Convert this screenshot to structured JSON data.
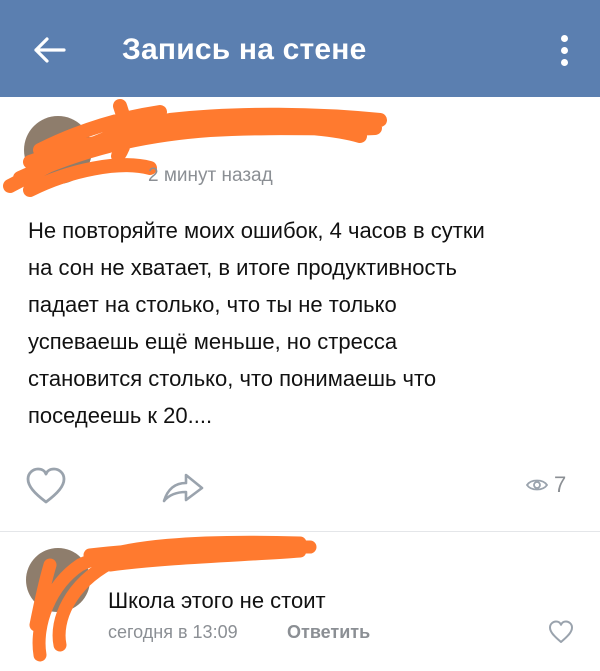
{
  "header": {
    "title": "Запись на стене",
    "background": "#5b7fb0",
    "back_icon": "arrow-left-icon",
    "menu_icon": "more-vertical-icon"
  },
  "post": {
    "time": "2 минут назад",
    "lines": [
      "Не повторяйте моих ошибок, 4 часов в сутки",
      "на сон не хватает, в итоге продуктивность",
      "падает на столько, что ты  не только",
      "успеваешь ещё меньше, но стресса",
      "становится столько, что понимаешь что",
      "поседеешь к 20...."
    ],
    "views": "7"
  },
  "comment": {
    "text": "Школа этого не стоит",
    "time": "сегодня в 13:09",
    "reply_label": "Ответить"
  },
  "colors": {
    "redaction": "#ff7a2f",
    "muted_text": "#8b8f94",
    "icon_gray": "#9aa3ad"
  }
}
